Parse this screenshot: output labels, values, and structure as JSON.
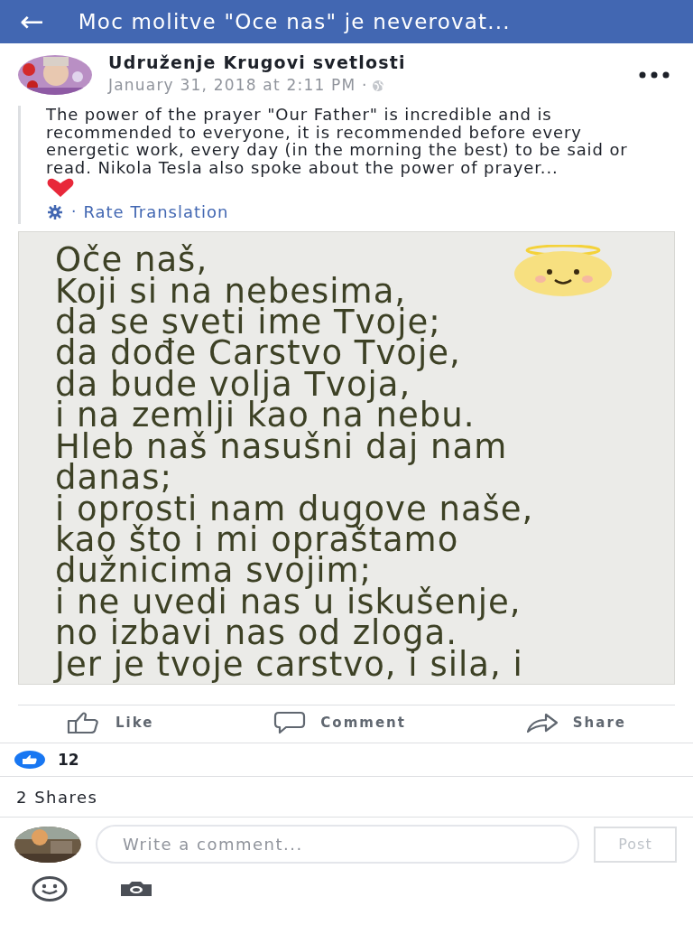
{
  "header": {
    "back": "←",
    "title": "Moc molitve \"Oce nas\" je neverovat..."
  },
  "post": {
    "author": "Udruženje Krugovi svetlosti",
    "timestamp": "January 31, 2018 at 2:11 PM ·",
    "text": "The power of the prayer \"Our Father\" is incredible and is recommended to everyone, it is recommended before every energetic work, every day (in the morning the best) to be said or read. Nikola Tesla also spoke about the power of prayer...",
    "translation_link": "Rate Translation",
    "translation_separator": "·"
  },
  "image": {
    "lines": [
      "Oče naš,",
      "Koji si na nebesima,",
      "da se sveti ime Tvoje;",
      "da dođe Carstvo Tvoje,",
      "da bude volja Tvoja,",
      "i na zemlji kao na nebu.",
      "Hleb naš nasušni daj nam",
      "danas;",
      "i oprosti nam dugove naše,",
      "kao što i mi opraštamo",
      "dužnicima svojim;",
      "i ne uvedi nas u iskušenje,",
      "no izbavi nas od zloga.",
      "Jer je tvoje carstvo, i sila, i"
    ]
  },
  "actions": [
    {
      "kind": "like",
      "label": "Like"
    },
    {
      "kind": "comment",
      "label": "Comment"
    },
    {
      "kind": "share",
      "label": "Share"
    }
  ],
  "reactions": {
    "count": "12"
  },
  "shares": "2 Shares",
  "comment_box": {
    "placeholder": "Write a comment...",
    "post_button": "Post",
    "disabled": true
  }
}
